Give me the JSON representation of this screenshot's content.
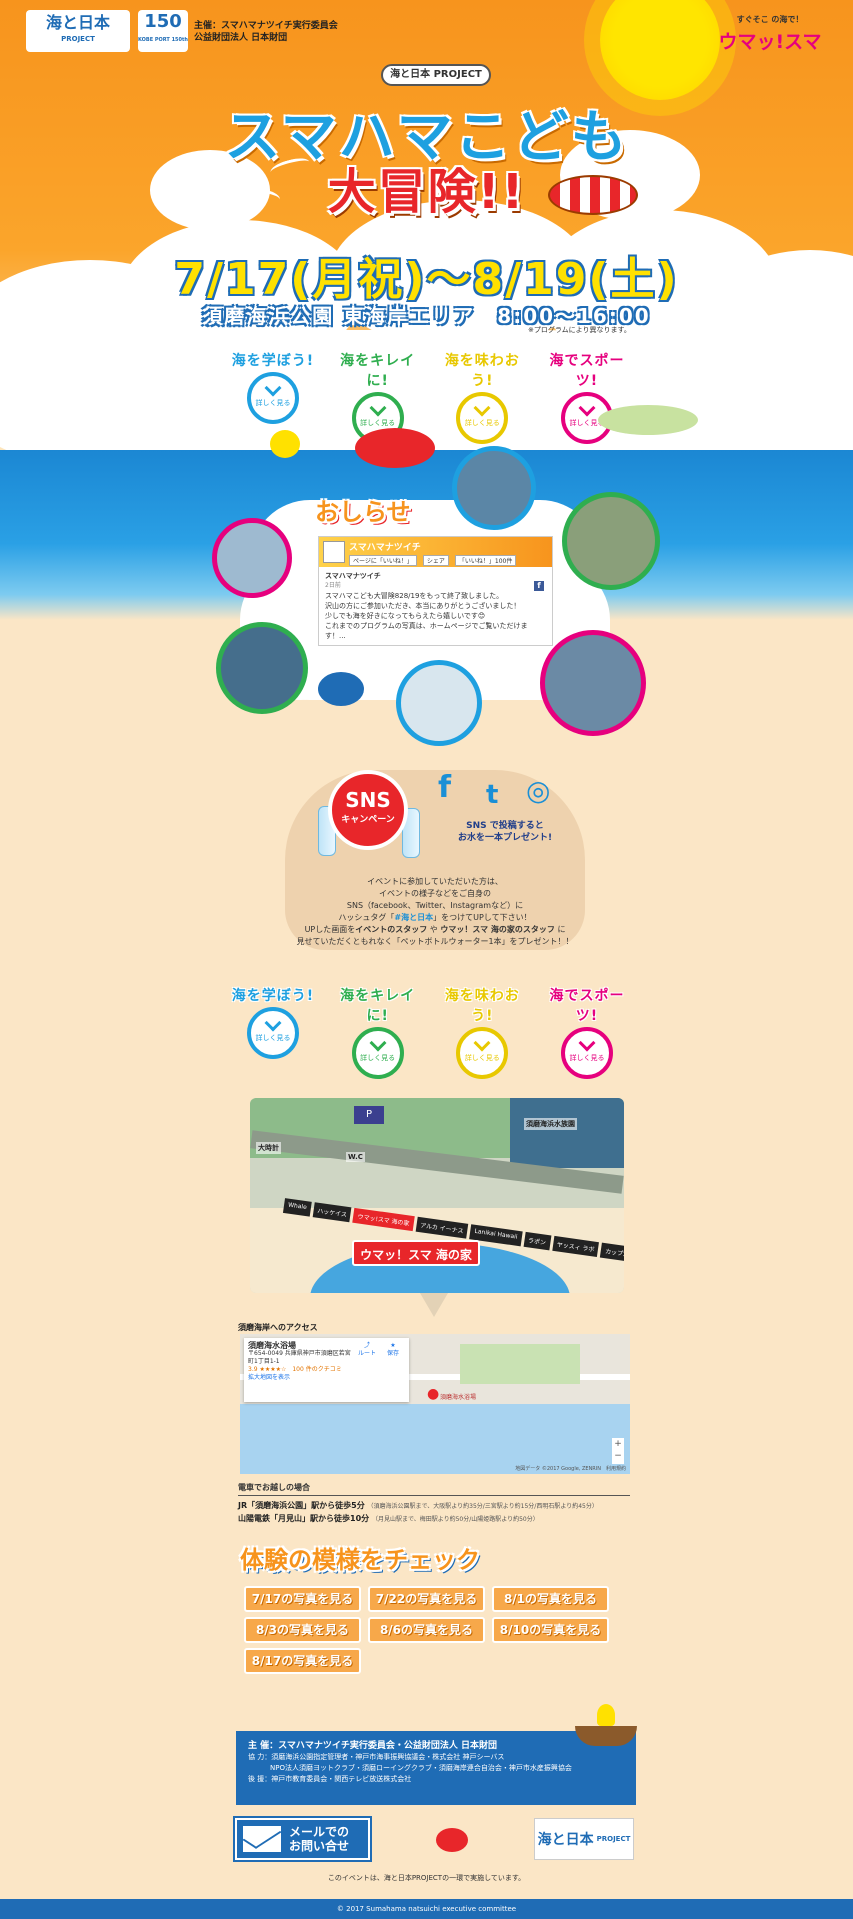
{
  "header": {
    "logo_nippon": "海と日本",
    "logo_nippon_sub": "PROJECT",
    "logo_port": "150",
    "logo_port_sub": "KOBE PORT 150th",
    "sponsors_line1": "主催：スマハマナツイチ実行委員会",
    "sponsors_line2": "公益財団法人 日本財団",
    "brand_small": "すぐそこ の海で！",
    "brand": "ウマッ!スマ"
  },
  "hero": {
    "project_pill": "海と日本 PROJECT",
    "title_line1": "スマハマこども",
    "title_line2": "大冒険!!",
    "date": "7/17(月祝)〜8/19(土)",
    "venue": "須磨海浜公園 東海岸エリア　8:00〜16:00",
    "venue_note": "※プログラムにより異なります。"
  },
  "categories": [
    {
      "label": "海を学ぼう!",
      "more": "詳しく見る",
      "color": "#1ea0e0"
    },
    {
      "label": "海をキレイに!",
      "more": "詳しく見る",
      "color": "#2fae4f"
    },
    {
      "label": "海を味わおう!",
      "more": "詳しく見る",
      "color": "#e8c800"
    },
    {
      "label": "海でスポーツ!",
      "more": "詳しく見る",
      "color": "#e6007e"
    }
  ],
  "news": {
    "title": "おしらせ",
    "fb_page": "スマハマナツイチ",
    "fb_tabs": [
      "ページに「いいね！」",
      "シェア",
      "「いいね！」100件"
    ],
    "post_author": "スマハマナツイチ",
    "post_time": "2日前",
    "post_text": [
      "スマハマこども大冒険828/19をもって終了致しました。",
      "沢山の方にご参加いただき、本当にありがとうございました！",
      "少しでも海を好きになってもらえたら嬉しいです😊",
      "これまでのプログラムの写真は、ホームページでご覧いただけます！..."
    ]
  },
  "sns": {
    "badge_main": "SNS",
    "badge_sub": "キャンペーン",
    "icon_facebook": "f",
    "icon_twitter": "t",
    "icon_instagram": "◎",
    "cta_line1": "SNS で投稿すると",
    "cta_line2": "お水を一本プレゼント!",
    "body_line1": "イベントに参加していただいた方は、",
    "body_line2": "イベントの様子などをご自身の",
    "body_line3": "SNS（facebook、Twitter、Instagramなど）に",
    "body_line4_pre": "ハッシュタグ「",
    "body_hashtag": "#海と日本",
    "body_line4_post": "」をつけてUPして下さい！",
    "body_line5_pre": "UPした画面を",
    "body_staff1": "イベントのスタッフ",
    "body_line5_mid": "や",
    "body_staff2": "ウマッ！スマ 海の家のスタッフ",
    "body_line5_post": "に",
    "body_line6": "見せていただくともれなく「ペットボトルウォーター1本」をプレゼント！！"
  },
  "map": {
    "label_clock": "大時計",
    "label_wc": "W.C",
    "label_aquarium": "須磨海浜水族園",
    "label_parking": "P",
    "stalls": [
      "Whale",
      "ハッケイス",
      "ウマッ!スマ 海の家",
      "アルカ イーナス",
      "Lanikai Hawaii",
      "ラポン",
      "ヤッスィ ラボ",
      "カップ大陸"
    ],
    "house_label": "ウマッ！スマ 海の家"
  },
  "access": {
    "title": "須磨海岸へのアクセス",
    "card_name": "須磨海水浴場",
    "card_address1": "〒654-0049 兵庫県神戸市須磨区若宮",
    "card_address2": "町1丁目1-1",
    "card_rating": "3.9 ★★★★☆　100 件のクチコミ",
    "card_link": "拡大地図を表示",
    "card_route": "ルート",
    "card_save": "保存",
    "pin_label": "須磨海水浴場",
    "map_footer": "地図データ ©2017 Google, ZENRIN　利用規約",
    "train_title": "電車でお越しの場合",
    "train1": "JR「須磨海浜公園」駅から徒歩5分",
    "train1_note": "（須磨海浜公園駅まで、大阪駅より約35分/三宮駅より約15分/西明石駅より約45分）",
    "train2": "山陽電鉄「月見山」駅から徒歩10分",
    "train2_note": "（月見山駅まで、梅田駅より約50分/山陽姫路駅より約50分）"
  },
  "report": {
    "title": "体験の模様をチェック",
    "buttons": [
      "7/17の写真を見る",
      "7/22の写真を見る",
      "8/1の写真を見る",
      "8/3の写真を見る",
      "8/6の写真を見る",
      "8/10の写真を見る",
      "8/17の写真を見る"
    ]
  },
  "footer": {
    "org_line1": "主 催：スマハマナツイチ実行委員会・公益財団法人 日本財団",
    "org_line2": "協 力：須磨海浜公園指定管理者・神戸市海事振興協議会・株式会社 神戸シーバス",
    "org_line3": "NPO法人須磨ヨットクラブ・須磨ローイングクラブ・須磨海岸連合自治会・神戸市水産振興協会",
    "org_line4": "後 援：神戸市教育委員会・関西テレビ放送株式会社",
    "mail_line1": "メールでの",
    "mail_line2": "お問い合せ",
    "footer_logo": "海と日本",
    "footer_logo_sub": "PROJECT",
    "note": "このイベントは、海と日本PROJECTの一環で実施しています。",
    "copyright": "© 2017 Sumahama natsuichi executive committee"
  },
  "colors": {
    "orange": "#f7941d",
    "blue": "#1f6cb5",
    "sea": "#2aa0e5",
    "sand": "#fbe6c6",
    "red": "#e8262a",
    "yellow": "#ffe100"
  }
}
